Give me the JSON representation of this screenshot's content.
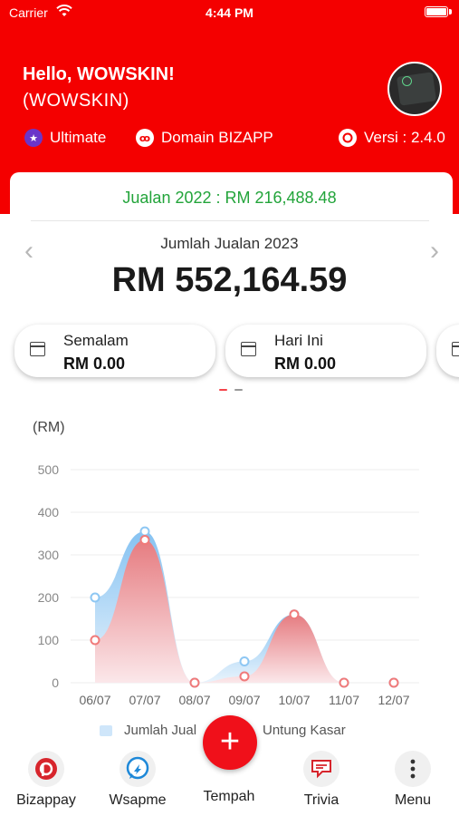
{
  "status_bar": {
    "carrier": "Carrier",
    "time": "4:44 PM"
  },
  "header": {
    "greeting": "Hello, WOWSKIN!",
    "company": "(WOWSKIN)",
    "plan": "Ultimate",
    "domain": "Domain BIZAPP",
    "version": "Versi : 2.4.0"
  },
  "sales": {
    "previous_year": "Jualan 2022 : RM 216,488.48",
    "total_title": "Jumlah Jualan 2023",
    "total_value": "RM 552,164.59"
  },
  "cards": [
    {
      "label": "Semalam",
      "amount": "RM 0.00"
    },
    {
      "label": "Hari Ini",
      "amount": "RM 0.00"
    }
  ],
  "chart_data": {
    "type": "area",
    "ylabel": "(RM)",
    "ylim": [
      0,
      500
    ],
    "yticks": [
      0,
      100,
      200,
      300,
      400,
      500
    ],
    "categories": [
      "06/07",
      "07/07",
      "08/07",
      "09/07",
      "10/07",
      "11/07",
      "12/07"
    ],
    "series": [
      {
        "name": "Jumlah Jual",
        "color": "#8ec7f3",
        "x": [
          0,
          1,
          2,
          3,
          4,
          5,
          6
        ],
        "values": [
          200,
          355,
          0,
          50,
          160,
          0,
          0
        ]
      },
      {
        "name": "Untung Kasar",
        "color": "#f07a7a",
        "x": [
          0,
          1,
          2,
          3,
          4,
          5,
          6
        ],
        "values": [
          100,
          335,
          0,
          15,
          160,
          0,
          0
        ]
      }
    ]
  },
  "nav": {
    "items": [
      {
        "label": "Bizappay"
      },
      {
        "label": "Wsapme"
      },
      {
        "label": "Tempah"
      },
      {
        "label": "Trivia"
      },
      {
        "label": "Menu"
      }
    ],
    "fab_symbol": "+"
  },
  "colors": {
    "brand_red": "#f40000",
    "green": "#22a43a"
  }
}
